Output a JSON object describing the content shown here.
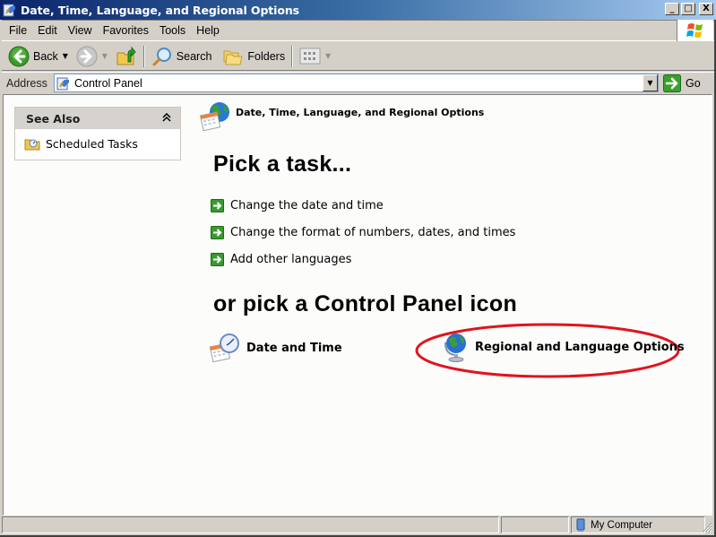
{
  "window": {
    "title": "Date, Time, Language, and Regional Options",
    "controls": {
      "minimize": "_",
      "maximize": "□",
      "close": "X"
    }
  },
  "menubar": {
    "items": [
      "File",
      "Edit",
      "View",
      "Favorites",
      "Tools",
      "Help"
    ]
  },
  "toolbar": {
    "back_label": "Back",
    "search_label": "Search",
    "folders_label": "Folders"
  },
  "addressbar": {
    "label": "Address",
    "value": "Control Panel",
    "go_label": "Go"
  },
  "sidebar": {
    "see_also": {
      "title": "See Also",
      "collapse_glyph": "«",
      "items": [
        {
          "label": "Scheduled Tasks",
          "icon": "scheduled-tasks-icon"
        }
      ]
    }
  },
  "main": {
    "category_title": "Date, Time, Language, and Regional Options",
    "pick_task_heading": "Pick a task...",
    "tasks": [
      {
        "label": "Change the date and time"
      },
      {
        "label": "Change the format of numbers, dates, and times"
      },
      {
        "label": "Add other languages"
      }
    ],
    "pick_icon_heading": "or pick a Control Panel icon",
    "icons": [
      {
        "label": "Date and Time",
        "icon": "clock-calendar-icon"
      },
      {
        "label": "Regional and Language Options",
        "icon": "globe-icon",
        "highlighted": true
      }
    ],
    "highlight_color": "#e0141e"
  },
  "statusbar": {
    "zone_label": "My Computer"
  }
}
